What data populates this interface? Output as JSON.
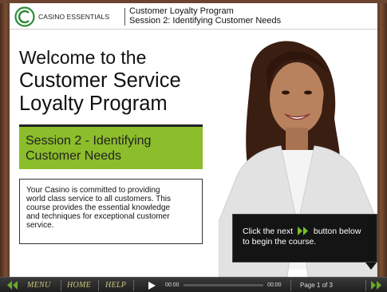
{
  "header": {
    "logo_text": "CASINO ESSENTIALS",
    "course_title": "Customer Loyalty Program",
    "session_title": "Session 2: Identifying Customer Needs"
  },
  "slide": {
    "welcome_line1": "Welcome to the",
    "welcome_line2": "Customer Service",
    "welcome_line3": "Loyalty Program",
    "session_line1": "Session 2 - Identifying",
    "session_line2": "Customer Needs",
    "intro_line1": "Your Casino is committed to providing",
    "intro_line2": "world class service to all customers. This",
    "intro_line3": "course provides the essential knowledge",
    "intro_line4": "and techniques for exceptional customer",
    "intro_line5": "service."
  },
  "callout": {
    "text_before": "Click the next",
    "text_after": "button below",
    "line2": "to begin the course."
  },
  "player": {
    "menu_label": "MENU",
    "home_label": "HOME",
    "help_label": "HELP",
    "time_elapsed": "00:00",
    "time_total": "00:00",
    "page_label": "Page 1 of 3",
    "progress": 0
  },
  "colors": {
    "accent_green": "#8cbd2a",
    "callout_bg": "#141414",
    "player_bar": "#2a2a2a"
  },
  "icons": {
    "logo": "casino-essentials-logo",
    "prev": "double-chevron-left-icon",
    "next": "double-chevron-right-icon",
    "play": "play-icon"
  }
}
